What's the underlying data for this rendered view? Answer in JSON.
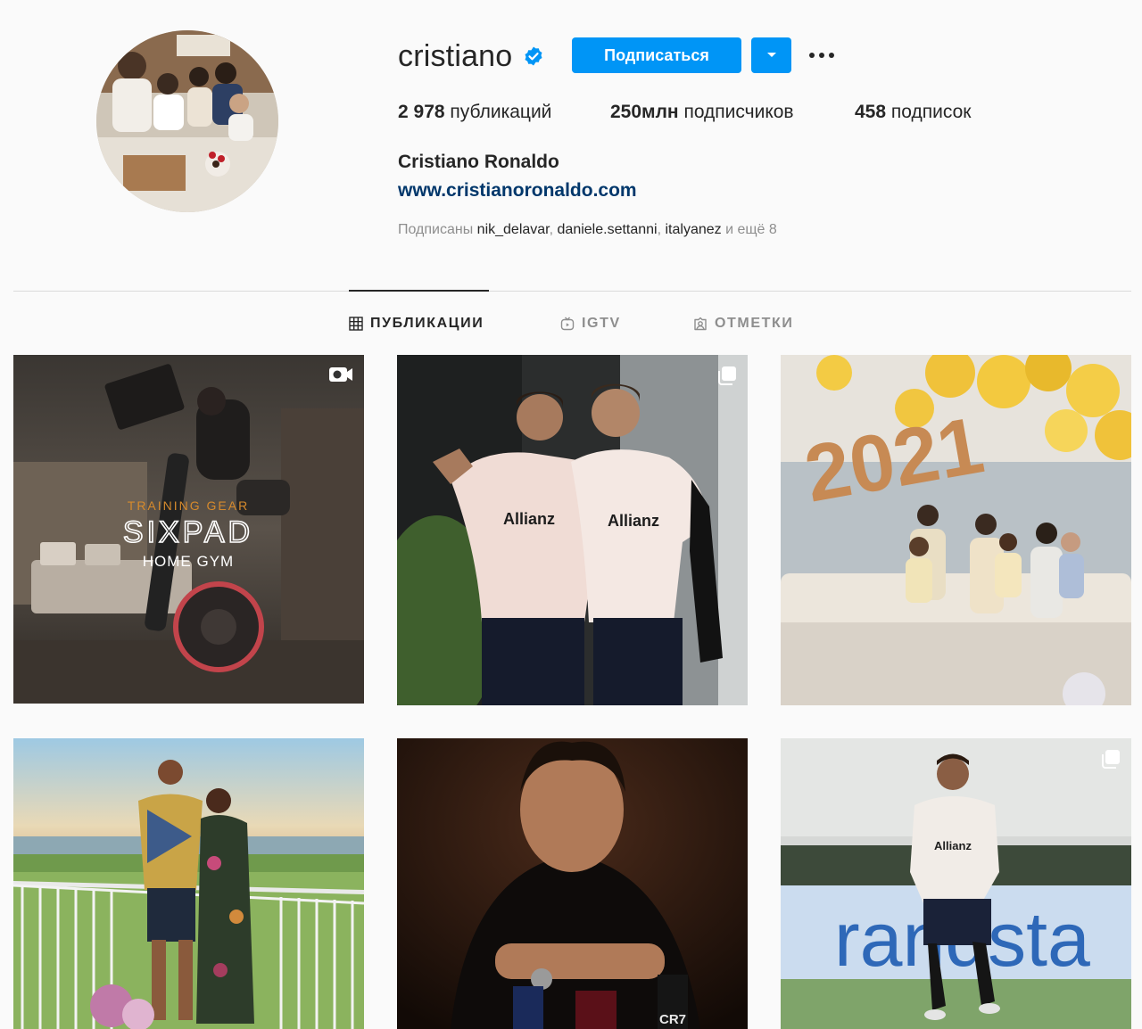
{
  "profile": {
    "username": "cristiano",
    "follow_label": "Подписаться",
    "full_name": "Cristiano Ronaldo",
    "website": "www.cristianoronaldo.com"
  },
  "stats": {
    "posts_value": "2 978",
    "posts_label": "публикаций",
    "followers_value": "250млн",
    "followers_label": "подписчиков",
    "following_value": "458",
    "following_label": "подписок"
  },
  "followed_by": {
    "prefix": "Подписаны",
    "accounts": [
      "nik_delavar",
      "daniele.settanni",
      "italyanez"
    ],
    "suffix": "и ещё 8"
  },
  "tabs": [
    {
      "label": "ПУБЛИКАЦИИ",
      "icon": "grid-icon",
      "active": true
    },
    {
      "label": "IGTV",
      "icon": "igtv-icon",
      "active": false
    },
    {
      "label": "ОТМЕТКИ",
      "icon": "tagged-icon",
      "active": false
    }
  ],
  "posts": [
    {
      "badge": "video-icon",
      "text": {
        "line1": "TRAINING GEAR",
        "line2": "SIXPAD",
        "line3": "HOME GYM"
      }
    },
    {
      "badge": "carousel-icon",
      "text": {
        "sponsor_a": "Allianz",
        "sponsor_b": "Allianz"
      }
    },
    {
      "badge": null,
      "text": {
        "balloons": "2021"
      }
    },
    {
      "badge": null
    },
    {
      "badge": null,
      "text": {
        "bottle": "CR7"
      }
    },
    {
      "badge": "carousel-icon",
      "text": {
        "banner": "randsta",
        "shirt": "Allianz"
      }
    }
  ],
  "colors": {
    "accent": "#0095f6",
    "link": "#00376b",
    "muted": "#8e8e8e",
    "text": "#262626"
  }
}
